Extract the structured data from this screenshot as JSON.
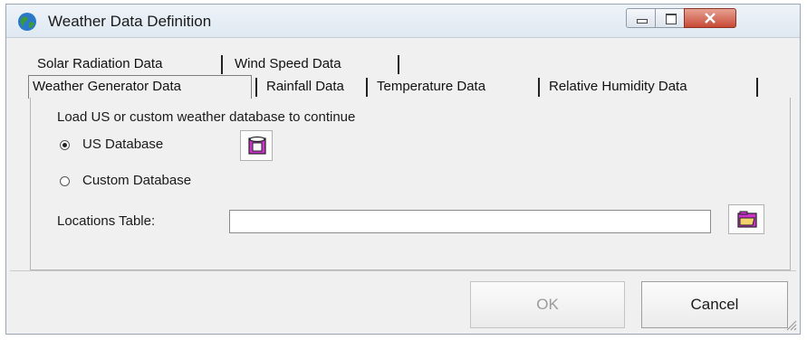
{
  "window": {
    "title": "Weather Data Definition",
    "icons": {
      "app": "globe-icon",
      "minimize": "minimize-icon",
      "maximize": "maximize-icon",
      "close": "close-icon"
    }
  },
  "tabs": {
    "row1": [
      {
        "label": "Solar Radiation Data"
      },
      {
        "label": "Wind Speed Data"
      }
    ],
    "row2": [
      {
        "label": "Weather Generator Data",
        "selected": true
      },
      {
        "label": "Rainfall Data"
      },
      {
        "label": "Temperature Data"
      },
      {
        "label": "Relative Humidity Data"
      }
    ]
  },
  "content": {
    "instruction": "Load US or custom weather database to continue",
    "us_database_label": "US Database",
    "custom_database_label": "Custom Database",
    "selected_option": "US Database",
    "locations_label": "Locations Table:",
    "locations_value": "",
    "icons": {
      "database": "database-icon",
      "folder": "open-folder-icon"
    }
  },
  "buttons": {
    "ok": "OK",
    "cancel": "Cancel",
    "ok_enabled": false
  },
  "colors": {
    "icon_accent": "#cc33cc",
    "close_button": "#c84a36"
  }
}
